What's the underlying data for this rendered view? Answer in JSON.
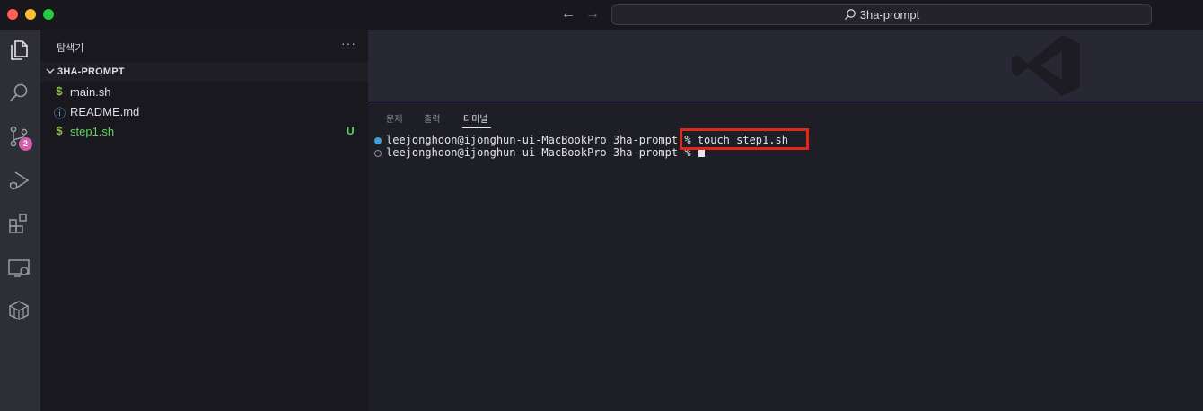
{
  "titlebar": {
    "search_text": "3ha-prompt",
    "back_arrow": "←",
    "forward_arrow": "→"
  },
  "activity_bar": {
    "items": [
      "explorer-icon",
      "search-icon",
      "source-control-icon",
      "run-debug-icon",
      "extensions-icon",
      "remote-explorer-icon",
      "docker-icon"
    ],
    "source_control_badge": "2"
  },
  "sidebar": {
    "title": "탐색기",
    "more": "···",
    "folder": "3HA-PROMPT",
    "files": [
      {
        "icon": "$",
        "name": "main.sh",
        "status": ""
      },
      {
        "icon": "ⓘ",
        "name": "README.md",
        "status": ""
      },
      {
        "icon": "$",
        "name": "step1.sh",
        "status": "U"
      }
    ]
  },
  "panel": {
    "tabs": [
      "문제",
      "출력",
      "터미널"
    ],
    "active_tab": "터미널",
    "terminal": {
      "lines": [
        "leejonghoon@ijonghun-ui-MacBookPro 3ha-prompt % touch step1.sh",
        "leejonghoon@ijonghun-ui-MacBookPro 3ha-prompt % "
      ]
    }
  },
  "colors": {
    "accent": "#8b7bb8",
    "untracked": "#5ed35e",
    "highlight": "#e3261a",
    "badge": "#d35fa8"
  }
}
